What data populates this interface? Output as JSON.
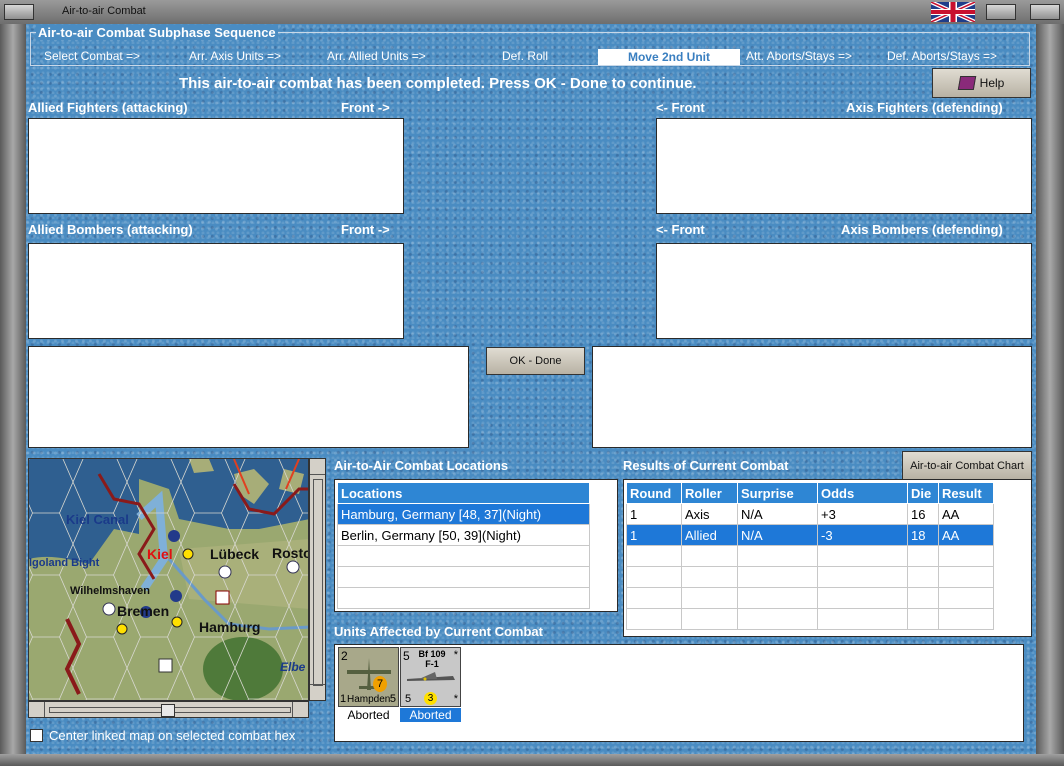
{
  "window": {
    "title": "Air-to-air Combat"
  },
  "sequence": {
    "title": "Air-to-air Combat Subphase Sequence",
    "steps": [
      "Select Combat =>",
      "Arr. Axis Units =>",
      "Arr. Allied Units =>",
      "Def. Roll",
      "Move 2nd Unit",
      "Att. Aborts/Stays =>",
      "Def. Aborts/Stays =>"
    ],
    "active_step": "Move 2nd Unit"
  },
  "message": "This air-to-air combat has been completed.  Press OK - Done to continue.",
  "help_button": "Help",
  "panels": {
    "allied_fighters": "Allied Fighters (attacking)",
    "allied_bombers": "Allied Bombers (attacking)",
    "axis_fighters": "Axis Fighters (defending)",
    "axis_bombers": "Axis Bombers (defending)",
    "front_right": "Front ->",
    "front_left": "<- Front"
  },
  "ok_button": "OK - Done",
  "map": {
    "labels": [
      "Kiel Canal",
      "Kiel",
      "Lübeck",
      "Rosto",
      "lgoland Bight",
      "Wilhelmshaven",
      "Bremen",
      "Hamburg",
      "Elbe"
    ]
  },
  "center_linked": {
    "label": "Center linked map on selected combat hex",
    "checked": false
  },
  "locations": {
    "title": "Air-to-Air Combat Locations",
    "header": "Locations",
    "rows": [
      "Hamburg, Germany [48, 37](Night)",
      "Berlin, Germany [50, 39](Night)"
    ],
    "selected_index": 0
  },
  "results": {
    "title": "Results of Current Combat",
    "chart_button": "Air-to-air Combat Chart",
    "columns": [
      "Round",
      "Roller",
      "Surprise",
      "Odds",
      "Die",
      "Result"
    ],
    "rows": [
      [
        "1",
        "Axis",
        "N/A",
        "+3",
        "16",
        "AA"
      ],
      [
        "1",
        "Allied",
        "N/A",
        "-3",
        "18",
        "AA"
      ]
    ],
    "selected_index": 1
  },
  "units": {
    "title": "Units Affected by Current Combat",
    "items": [
      {
        "name": "Hampden",
        "top_left": "2",
        "bottom_left": "1",
        "bottom_right": "5",
        "badge": "7",
        "status": "Aborted",
        "selected": false
      },
      {
        "name": "Bf 109 F-1",
        "top_left": "5",
        "bottom_left": "5",
        "bottom_right": "*",
        "badge": "3",
        "status": "Aborted",
        "selected": true
      }
    ]
  },
  "colors": {
    "accent": "#1e78d8",
    "background": "#4a8cc2"
  }
}
